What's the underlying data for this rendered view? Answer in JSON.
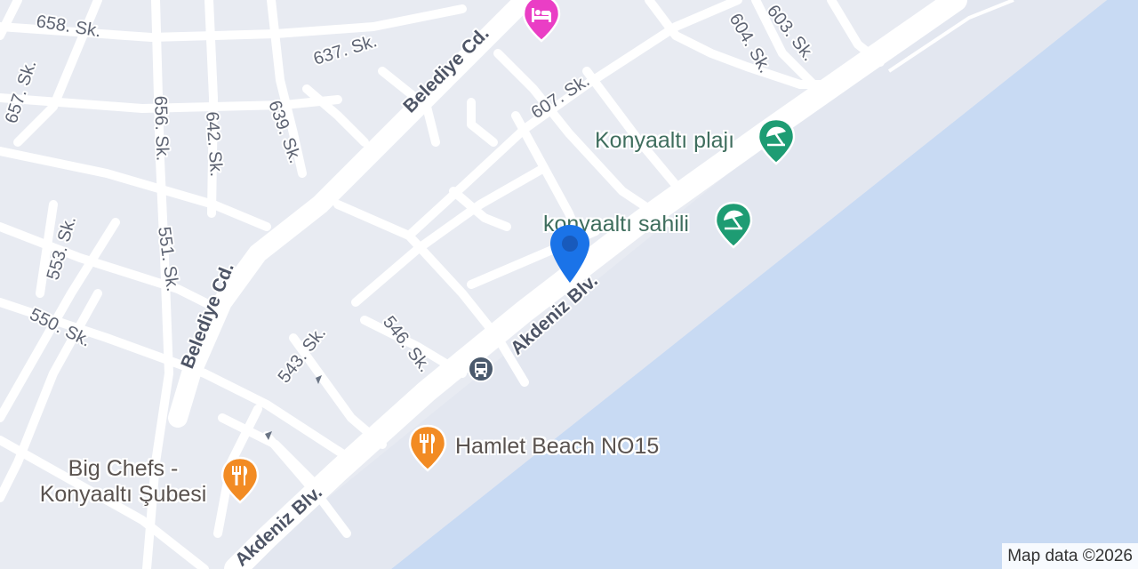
{
  "map": {
    "colors": {
      "land": "#e8ebf2",
      "water": "#c8daf3",
      "beach": "#e3e7f0",
      "road": "#ffffff",
      "poi_green": "#1e9c73",
      "poi_orange": "#f28b23",
      "poi_pink": "#ea3ec5",
      "location_pin": "#1a73e8",
      "transit": "#4b5a6d"
    },
    "streets": {
      "s658": "658. Sk.",
      "s637": "637. Sk.",
      "belediye_top": "Belediye Cd.",
      "s657": "657. Sk.",
      "s656": "656. Sk.",
      "s642": "642. Sk.",
      "s639": "639. Sk.",
      "s607": "607. Sk.",
      "s604": "604. Sk.",
      "s603": "603. Sk.",
      "s553": "553. Sk.",
      "s551": "551. Sk.",
      "s550": "550. Sk.",
      "belediye_bottom": "Belediye Cd.",
      "s543": "543. Sk.",
      "s546": "546. Sk.",
      "akdeniz_mid": "Akdeniz Blv.",
      "akdeniz_low": "Akdeniz Blv."
    },
    "pois": [
      {
        "id": "konyaalti-plaji",
        "label": "Konyaaltı plajı",
        "icon": "beach-umbrella-icon",
        "category": "beach"
      },
      {
        "id": "konyaalti-sahili",
        "label": "konyaaltı sahili",
        "icon": "beach-umbrella-icon",
        "category": "beach"
      },
      {
        "id": "hamlet-beach",
        "label": "Hamlet Beach NO15",
        "icon": "fork-knife-icon",
        "category": "restaurant"
      },
      {
        "id": "big-chefs",
        "label_line1": "Big Chefs -",
        "label_line2": "Konyaaltı Şubesi",
        "icon": "fork-knife-icon",
        "category": "restaurant"
      },
      {
        "id": "hotel",
        "label": "",
        "icon": "bed-icon",
        "category": "hotel"
      },
      {
        "id": "bus-stop",
        "label": "",
        "icon": "bus-icon",
        "category": "transit"
      }
    ],
    "marker": {
      "icon": "location-pin-icon"
    },
    "credit": "Map data ©2026"
  }
}
